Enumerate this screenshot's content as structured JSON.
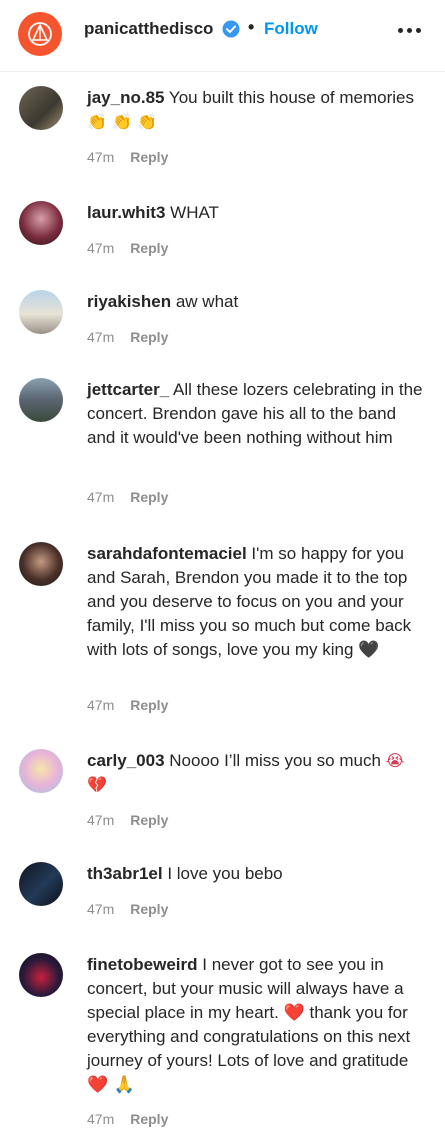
{
  "header": {
    "account_name": "panicatthedisco",
    "separator": "•",
    "follow_label": "Follow",
    "avatar_icon": "disco-logo-icon",
    "more_icon": "more-options-icon"
  },
  "comments": [
    {
      "username": "jay_no.85",
      "text": "You built this house of memories",
      "emoji": "👏 👏 👏",
      "time": "47m",
      "reply": "Reply"
    },
    {
      "username": "laur.whit3",
      "text": "WHAT",
      "emoji": "",
      "time": "47m",
      "reply": "Reply"
    },
    {
      "username": "riyakishen",
      "text": "aw what",
      "emoji": "",
      "time": "47m",
      "reply": "Reply"
    },
    {
      "username": "jettcarter_",
      "text": "All these lozers celebrating in the concert. Brendon gave his all to the band and it would've been nothing without him",
      "emoji": "",
      "time": "47m",
      "reply": "Reply"
    },
    {
      "username": "sarahdafontemaciel",
      "text": "I'm so happy for you and Sarah, Brendon you made it to the top and you deserve to focus on you and your family, I'll miss you so much but come back with lots of songs, love you my king",
      "emoji": "🖤",
      "time": "47m",
      "reply": "Reply"
    },
    {
      "username": "carly_003",
      "text": "Noooo I’ll miss you so much",
      "emoji": "😭 💔",
      "time": "47m",
      "reply": "Reply"
    },
    {
      "username": "th3abr1el",
      "text": "I love you bebo",
      "emoji": "",
      "time": "47m",
      "reply": "Reply"
    },
    {
      "username": "finetobeweird",
      "text": "I never got to see you in concert, but your music will always have a special place in my heart.",
      "emoji": "❤️",
      "text2": "thank you for everything and congratulations on this next journey of yours! Lots of love and gratitude",
      "emoji2": "❤️ 🙏",
      "time": "47m",
      "reply": "Reply"
    }
  ],
  "colors": {
    "link_blue": "#0095f6",
    "avatar_orange": "#f4552e",
    "meta_gray": "#8e8e8e"
  }
}
